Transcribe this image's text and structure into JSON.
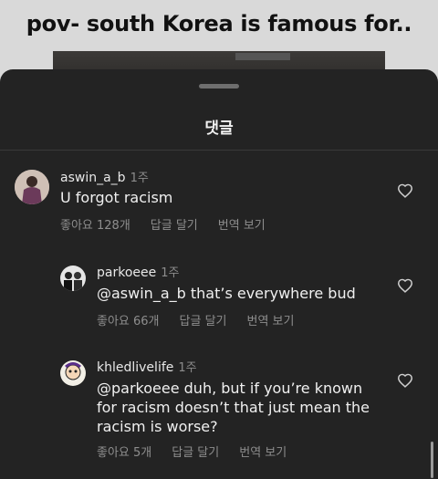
{
  "background": {
    "caption": "pov- south Korea is famous for.."
  },
  "sheet": {
    "title": "댓글"
  },
  "comments": [
    {
      "username": "aswin_a_b",
      "time": "1주",
      "text": "U forgot racism",
      "likes_label": "좋아요 128개",
      "reply_label": "답글 달기",
      "translate_label": "번역 보기"
    },
    {
      "username": "parkoeee",
      "time": "1주",
      "text": "@aswin_a_b that’s everywhere bud",
      "likes_label": "좋아요 66개",
      "reply_label": "답글 달기",
      "translate_label": "번역 보기"
    },
    {
      "username": "khledlivelife",
      "time": "1주",
      "text": "@parkoeee duh, but if you’re known for racism doesn’t that just mean the racism is worse?",
      "likes_label": "좋아요 5개",
      "reply_label": "답글 달기",
      "translate_label": "번역 보기"
    }
  ],
  "icons": {
    "like": "heart-outline-icon"
  }
}
